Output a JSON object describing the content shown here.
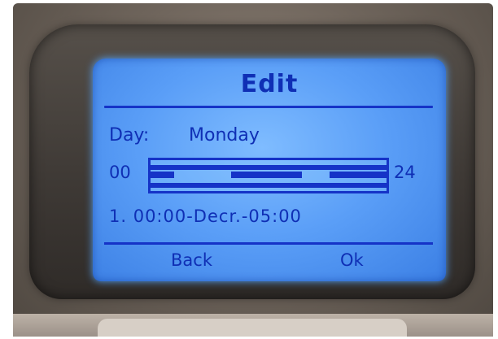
{
  "screen": {
    "title": "Edit",
    "day_label": "Day:",
    "day_value": "Monday",
    "timeline_start": "00",
    "timeline_end": "24",
    "program_line": "1.  00:00-Decr.-05:00",
    "softkeys": {
      "back": "Back",
      "ok": "Ok"
    }
  },
  "colors": {
    "lcd_background": "#5a9ef7",
    "lcd_text": "#0f2fb5"
  }
}
